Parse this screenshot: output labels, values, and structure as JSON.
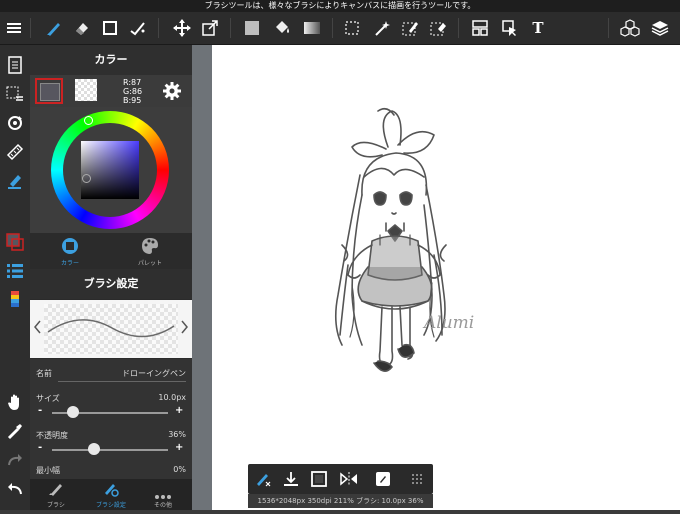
{
  "status_bar": {
    "message": "ブラシツールは、様々なブラシによりキャンバスに描画を行うツールです。"
  },
  "toolbar": {
    "text_tool": "T"
  },
  "color_panel": {
    "title": "カラー",
    "r_label": "R:87",
    "g_label": "G:86",
    "b_label": "B:95",
    "main_color": "#57565f",
    "tabs": {
      "color": "カラー",
      "palette": "パレット"
    }
  },
  "brush_panel": {
    "title": "ブラシ設定",
    "name_label": "名前",
    "name_value": "ドローイングペン",
    "size_label": "サイズ",
    "size_value": "10.0px",
    "opacity_label": "不透明度",
    "opacity_value": "36%",
    "min_width_label": "最小幅",
    "min_width_value": "0%",
    "size_level": 0.18,
    "opacity_level": 0.36
  },
  "bottom_tabs": {
    "brush": "ブラシ",
    "brush_settings": "ブラシ設定",
    "other": "その他"
  },
  "canvas_info": "1536*2048px 350dpi 211% ブラシ: 10.0px 36%",
  "signature": "Alumi",
  "colors": {
    "accent": "#3ca0e0",
    "highlight": "#cc2222"
  }
}
